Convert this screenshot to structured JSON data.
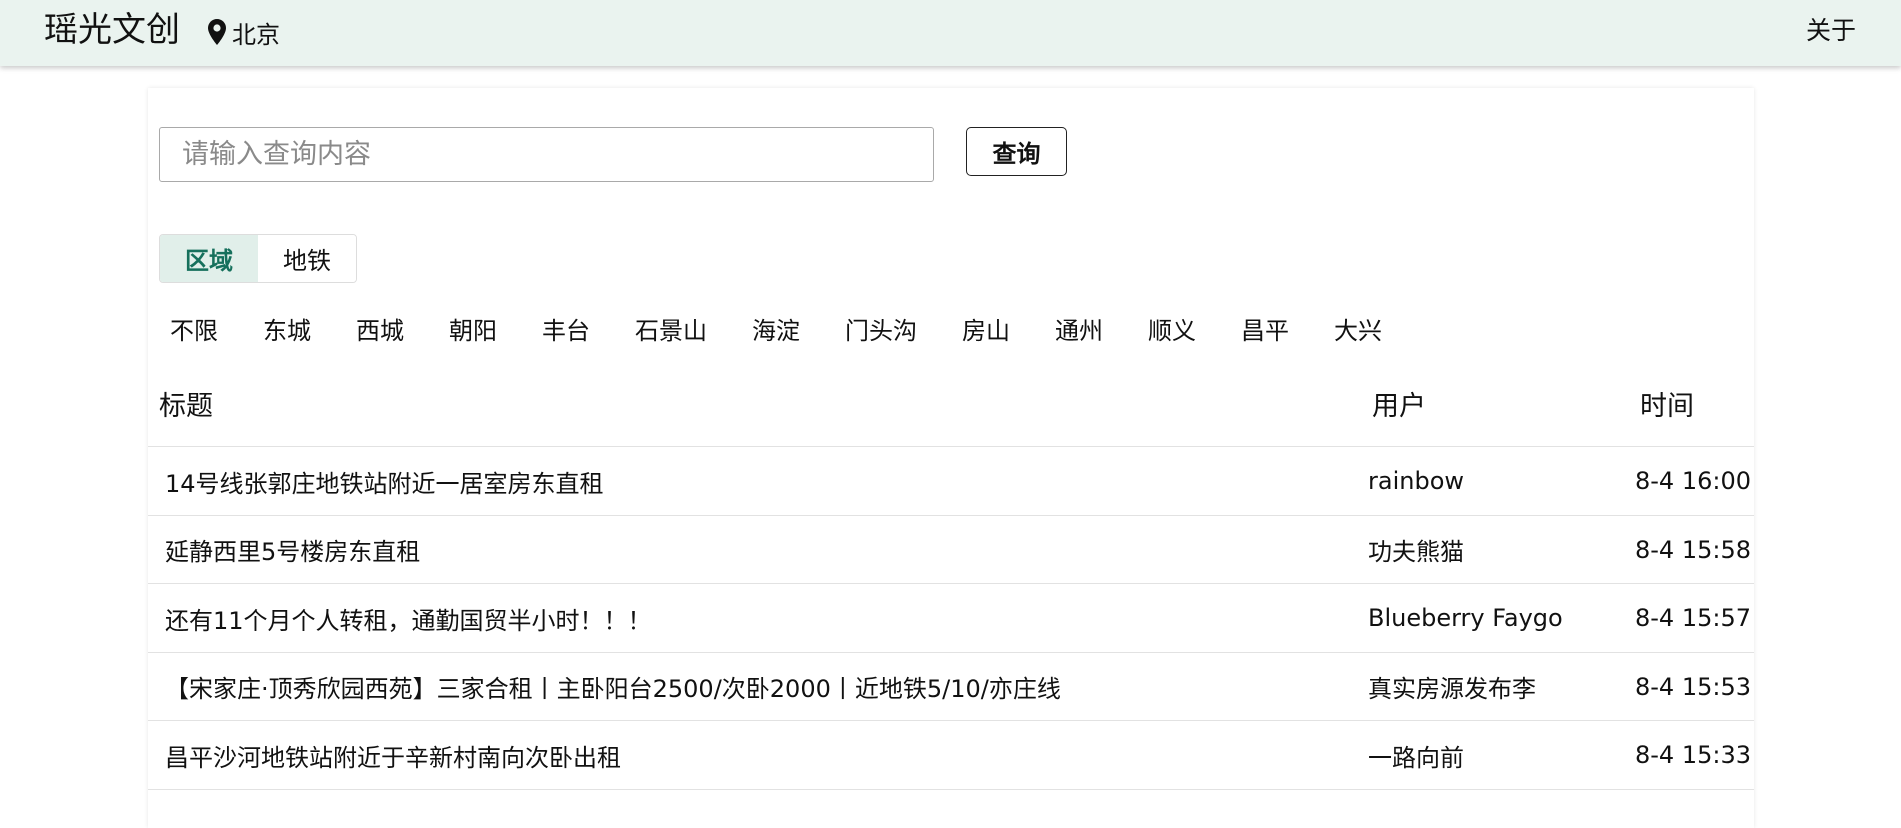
{
  "header": {
    "brand": "瑶光文创",
    "city_icon": "map-pin-icon",
    "city": "北京",
    "about": "关于"
  },
  "search": {
    "placeholder": "请输入查询内容",
    "value": "",
    "button_label": "查询"
  },
  "tabs": [
    {
      "label": "区域",
      "active": true
    },
    {
      "label": "地铁",
      "active": false
    }
  ],
  "districts": [
    "不限",
    "东城",
    "西城",
    "朝阳",
    "丰台",
    "石景山",
    "海淀",
    "门头沟",
    "房山",
    "通州",
    "顺义",
    "昌平",
    "大兴"
  ],
  "table": {
    "columns": {
      "title": "标题",
      "user": "用户",
      "time": "时间"
    },
    "rows": [
      {
        "title": "14号线张郭庄地铁站附近一居室房东直租",
        "user": "rainbow",
        "time": "8-4 16:00"
      },
      {
        "title": "延静西里5号楼房东直租",
        "user": "功夫熊猫",
        "time": "8-4 15:58"
      },
      {
        "title": "还有11个月个人转租，通勤国贸半小时！！！",
        "user": "Blueberry Faygo",
        "time": "8-4 15:57"
      },
      {
        "title": "【宋家庄·顶秀欣园西苑】三家合租丨主卧阳台2500/次卧2000丨近地铁5/10/亦庄线",
        "user": "真实房源发布李",
        "time": "8-4 15:53"
      },
      {
        "title": "昌平沙河地铁站附近于辛新村南向次卧出租",
        "user": "一路向前",
        "time": "8-4 15:33"
      }
    ]
  },
  "colors": {
    "header_bg": "#eaf3ef",
    "tab_active_bg": "#e1efea",
    "tab_active_text": "#16705c"
  }
}
